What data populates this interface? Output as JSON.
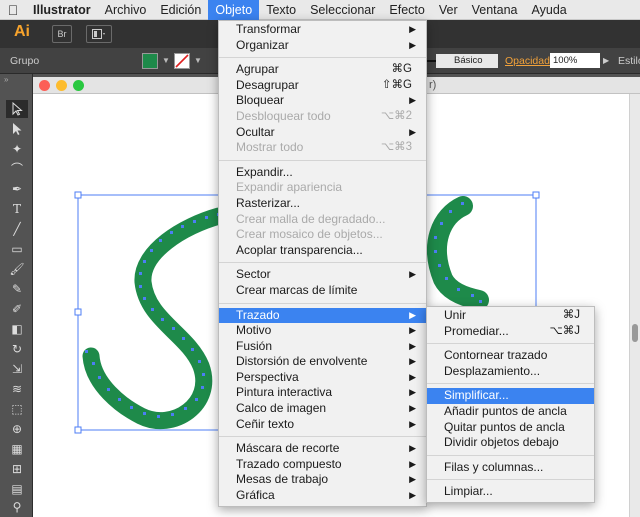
{
  "menubar": {
    "app": "Illustrator",
    "items": [
      "Archivo",
      "Edición",
      "Objeto",
      "Texto",
      "Seleccionar",
      "Efecto",
      "Ver",
      "Ventana",
      "Ayuda"
    ],
    "active": "Objeto"
  },
  "appbar": {
    "logo": "Ai",
    "btn1": "Br"
  },
  "ctrlbar": {
    "selection_label": "Grupo",
    "fill_color": "#1e8a4a",
    "stroke_label": "Básico",
    "opacity_label": "Opacidad:",
    "opacity_value": "100%",
    "style_label": "Estilo"
  },
  "document": {
    "title_suffix": "r)"
  },
  "objeto_menu": {
    "transformar": "Transformar",
    "organizar": "Organizar",
    "agrupar": "Agrupar",
    "agrupar_sc": "⌘G",
    "desagrupar": "Desagrupar",
    "desagrupar_sc": "⇧⌘G",
    "bloquear": "Bloquear",
    "desbloquear": "Desbloquear todo",
    "desbloquear_sc": "⌥⌘2",
    "ocultar": "Ocultar",
    "mostrar": "Mostrar todo",
    "mostrar_sc": "⌥⌘3",
    "expandir": "Expandir...",
    "expandir_apariencia": "Expandir apariencia",
    "rasterizar": "Rasterizar...",
    "malla": "Crear malla de degradado...",
    "mosaico": "Crear mosaico de objetos...",
    "acoplar": "Acoplar transparencia...",
    "sector": "Sector",
    "marcas": "Crear marcas de límite",
    "trazado": "Trazado",
    "motivo": "Motivo",
    "fusion": "Fusión",
    "distorsion": "Distorsión de envolvente",
    "perspectiva": "Perspectiva",
    "pintura": "Pintura interactiva",
    "calco": "Calco de imagen",
    "cenir": "Ceñir texto",
    "mascara": "Máscara de recorte",
    "compuesto": "Trazado compuesto",
    "mesas": "Mesas de trabajo",
    "grafica": "Gráfica"
  },
  "trazado_menu": {
    "unir": "Unir",
    "unir_sc": "⌘J",
    "promediar": "Promediar...",
    "promediar_sc": "⌥⌘J",
    "contornear": "Contornear trazado",
    "desplazamiento": "Desplazamiento...",
    "simplificar": "Simplificar...",
    "anadir": "Añadir puntos de ancla",
    "quitar": "Quitar puntos de ancla",
    "dividir": "Dividir objetos debajo",
    "filas": "Filas y columnas...",
    "limpiar": "Limpiar..."
  },
  "icons": [
    "apple-icon",
    "bridge-icon",
    "arrange-icon",
    "fill-swatch",
    "stroke-none-swatch",
    "submenu-arrow-icon",
    "selection-tool-icon",
    "direct-selection-icon",
    "magic-wand-icon",
    "pen-tool-icon",
    "type-tool-icon",
    "line-tool-icon",
    "rectangle-tool-icon",
    "paintbrush-icon",
    "pencil-icon",
    "eraser-icon",
    "rotate-icon",
    "scale-icon",
    "warp-icon",
    "free-transform-icon",
    "shape-builder-icon",
    "perspective-grid-icon",
    "mesh-tool-icon",
    "gradient-tool-icon"
  ],
  "colors": {
    "accent": "#3b83f0",
    "art_green": "#1e8a4a",
    "selection": "#4d7ef5",
    "ui_dark": "#323232",
    "ai_orange": "#f7a32c"
  }
}
